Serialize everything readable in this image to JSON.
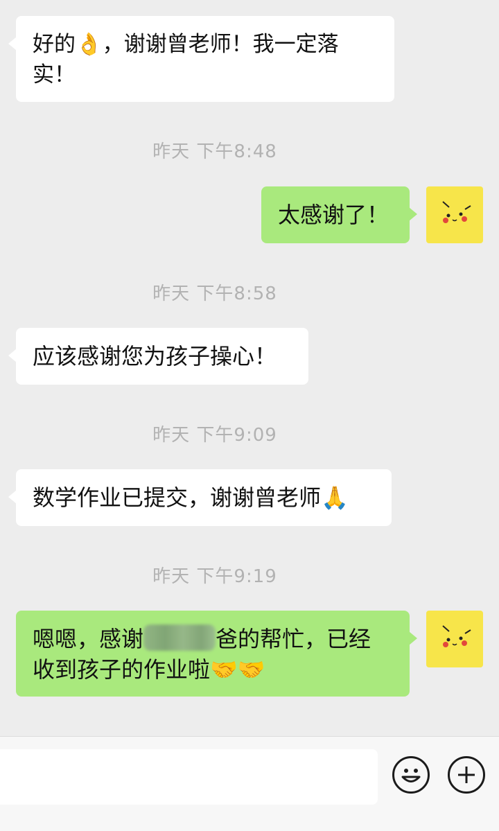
{
  "messages": [
    {
      "text": "好的👌，谢谢曾老师！我一定落实！"
    },
    {
      "timestamp": "昨天 下午8:48"
    },
    {
      "text": "太感谢了！"
    },
    {
      "timestamp": "昨天 下午8:58"
    },
    {
      "text": "应该感谢您为孩子操心！"
    },
    {
      "timestamp": "昨天 下午9:09"
    },
    {
      "text": "数学作业已提交，谢谢曾老师🙏"
    },
    {
      "timestamp": "昨天 下午9:19"
    },
    {
      "text_part1": "嗯嗯，感谢",
      "text_part2": "爸的帮忙，已经",
      "text_part3": "收到孩子的作业啦🤝🤝"
    }
  ],
  "colors": {
    "incoming": "#ffffff",
    "outgoing": "#a9e97d",
    "avatar": "#f7e54a",
    "background": "#ededed"
  },
  "icons": {
    "emoji_button": "smiley-face-icon",
    "more_button": "plus-icon",
    "avatar": "pikachu-avatar"
  }
}
